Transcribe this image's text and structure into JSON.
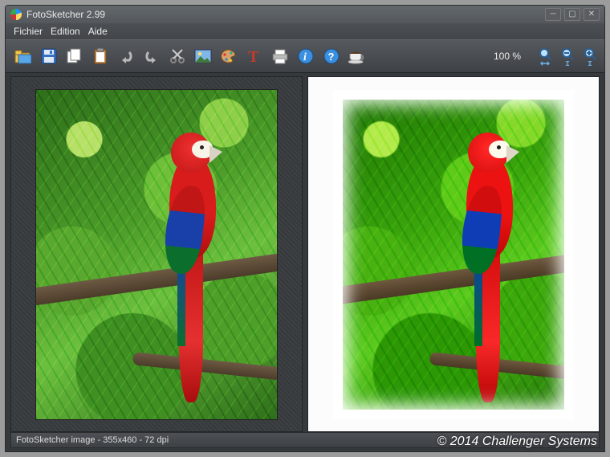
{
  "window": {
    "title": "FotoSketcher 2.99"
  },
  "menubar": {
    "file": "Fichier",
    "edit": "Edition",
    "help": "Aide"
  },
  "toolbar": {
    "icons": {
      "open": "open-folder-icon",
      "save": "save-icon",
      "batch": "copy-icon",
      "clipboard": "clipboard-icon",
      "undo": "undo-icon",
      "redo": "redo-icon",
      "crop": "scissors-icon",
      "resize": "image-icon",
      "palette": "palette-icon",
      "text": "text-icon",
      "print": "print-icon",
      "info": "info-icon",
      "help": "help-icon",
      "coffee": "coffee-icon"
    },
    "zoom_label": "100 %",
    "zoom_icons": {
      "fit": "zoom-fit-icon",
      "out": "zoom-out-icon",
      "in": "zoom-in-icon"
    }
  },
  "statusbar": {
    "text": "FotoSketcher image - 355x460 - 72 dpi"
  },
  "watermark": "© 2014 Challenger Systems",
  "panels": {
    "left_alt": "Source photo — scarlet macaw perched on branch among palm fronds",
    "right_alt": "Watercolour-sketch rendering of the same scarlet macaw scene"
  }
}
